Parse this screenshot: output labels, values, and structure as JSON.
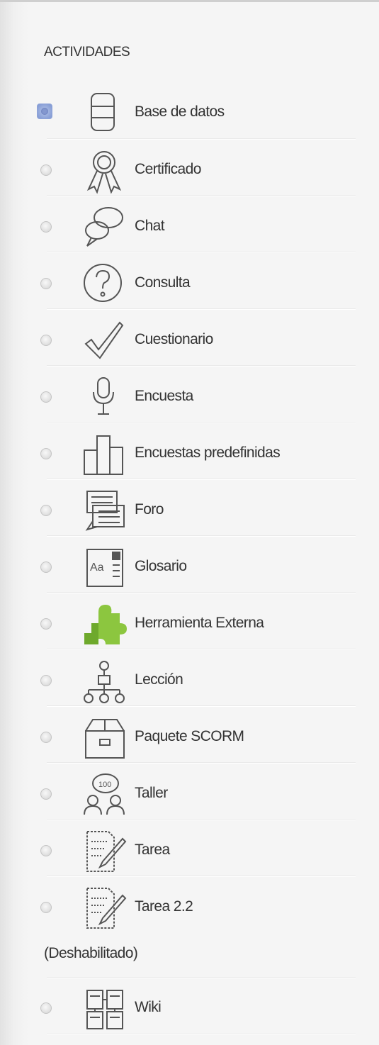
{
  "section": {
    "title": "ACTIVIDADES"
  },
  "activities": [
    {
      "label": "Base de datos",
      "icon": "database-icon",
      "selected": true
    },
    {
      "label": "Certificado",
      "icon": "certificate-ribbon-icon",
      "selected": false
    },
    {
      "label": "Chat",
      "icon": "chat-bubbles-icon",
      "selected": false
    },
    {
      "label": "Consulta",
      "icon": "question-circle-icon",
      "selected": false
    },
    {
      "label": "Cuestionario",
      "icon": "checkmark-icon",
      "selected": false
    },
    {
      "label": "Encuesta",
      "icon": "microphone-icon",
      "selected": false
    },
    {
      "label": "Encuestas predefinidas",
      "icon": "bar-chart-icon",
      "selected": false
    },
    {
      "label": "Foro",
      "icon": "forum-icon",
      "selected": false
    },
    {
      "label": "Glosario",
      "icon": "glossary-icon",
      "selected": false
    },
    {
      "label": "Herramienta Externa",
      "icon": "puzzle-piece-icon",
      "selected": false
    },
    {
      "label": "Lección",
      "icon": "hierarchy-icon",
      "selected": false
    },
    {
      "label": "Paquete SCORM",
      "icon": "package-box-icon",
      "selected": false
    },
    {
      "label": "Taller",
      "icon": "workshop-people-icon",
      "selected": false
    },
    {
      "label": "Tarea",
      "icon": "assignment-pencil-icon",
      "selected": false
    },
    {
      "label": "Tarea 2.2",
      "icon": "assignment-pencil-icon",
      "selected": false,
      "note": "(Deshabilitado)"
    },
    {
      "label": "Wiki",
      "icon": "wiki-pages-icon",
      "selected": false
    }
  ],
  "colors": {
    "selected_radio": "#8ea4d9",
    "puzzle_green": "#8cc63f",
    "icon_stroke": "#555555"
  }
}
